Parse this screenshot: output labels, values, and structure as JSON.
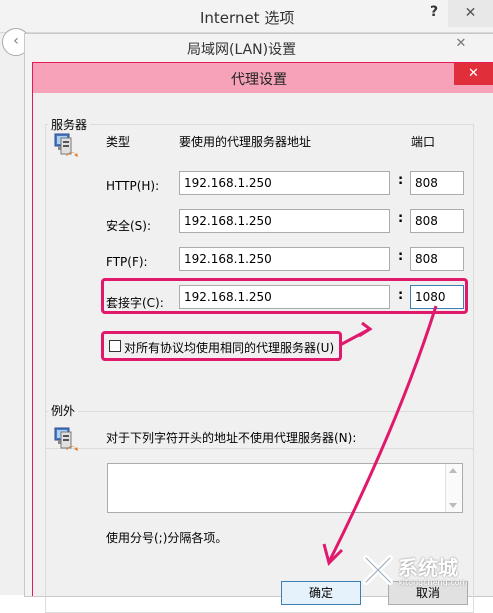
{
  "internet_options": {
    "title": "Internet 选项",
    "help": "?",
    "close": "✕",
    "back": "‹"
  },
  "lan_settings": {
    "title": "局域网(LAN)设置",
    "close": "✕"
  },
  "proxy_settings": {
    "title": "代理设置",
    "close": "✕",
    "servers_group": "服务器",
    "col_type": "类型",
    "col_address": "要使用的代理服务器地址",
    "col_port": "端口",
    "rows": [
      {
        "label": "HTTP(H):",
        "address": "192.168.1.250",
        "port": "808"
      },
      {
        "label": "安全(S):",
        "address": "192.168.1.250",
        "port": "808"
      },
      {
        "label": "FTP(F):",
        "address": "192.168.1.250",
        "port": "808"
      },
      {
        "label": "套接字(C):",
        "address": "192.168.1.250",
        "port": "1080"
      }
    ],
    "same_proxy_label": "对所有协议均使用相同的代理服务器(U)",
    "exceptions_group": "例外",
    "exceptions_desc": "对于下列字符开头的地址不使用代理服务器(N):",
    "exceptions_value": "",
    "exceptions_hint": "使用分号(;)分隔各项。",
    "ok_label": "确定",
    "cancel_label": "取消"
  },
  "colors": {
    "highlight": "#e0196c",
    "close_red": "#e02e3a",
    "title_pink": "#f6a3b9"
  },
  "watermark": {
    "brand": "系统城",
    "url": "xitongcheng.com"
  }
}
